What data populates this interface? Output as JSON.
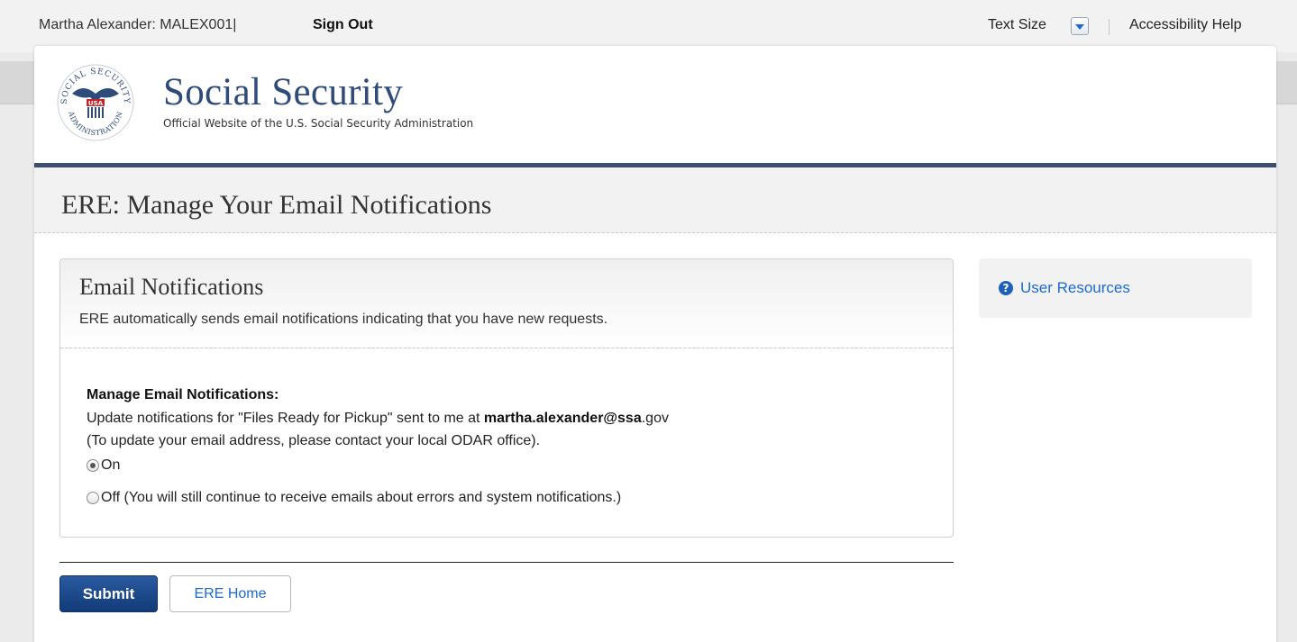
{
  "utility": {
    "user_info": "Martha Alexander: MALEX001|",
    "sign_out": "Sign Out",
    "text_size": "Text Size",
    "accessibility_help": "Accessibility Help"
  },
  "header": {
    "site_title": "Social Security",
    "site_subtitle": "Official Website of the U.S. Social Security Administration",
    "seal_icon": "ssa-seal-icon",
    "seal_text_top": "SOCIAL SECURITY",
    "seal_text_bottom": "ADMINISTRATION",
    "seal_usa": "USA"
  },
  "page": {
    "title": "ERE: Manage Your Email Notifications"
  },
  "panel": {
    "title": "Email Notifications",
    "description": "ERE automatically sends email notifications indicating that you have new requests.",
    "manage_label": "Manage Email Notifications:",
    "update_prefix": "Update notifications for \"Files Ready for Pickup\" sent to me at ",
    "email_bold": "martha.alexander@ssa",
    "email_suffix": ".gov",
    "contact_note": "(To update your email address, please contact your local ODAR office).",
    "options": [
      {
        "label": "On",
        "selected": true
      },
      {
        "label": "Off (You will still continue to receive emails about errors and system notifications.)",
        "selected": false
      }
    ]
  },
  "actions": {
    "submit": "Submit",
    "home": "ERE Home"
  },
  "sidebar": {
    "user_resources": "User Resources",
    "icon": "help-circle-icon"
  },
  "colors": {
    "brand_navy": "#2f4b7a",
    "rule": "#3c4f71",
    "link": "#1b6ad1",
    "submit_bg": "#1a4a8c"
  }
}
